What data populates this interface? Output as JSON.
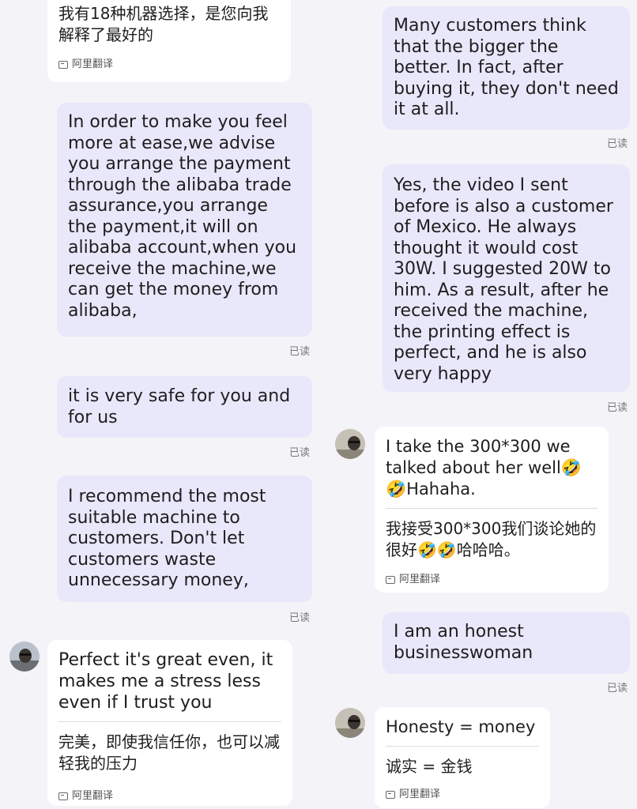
{
  "translate_tag": "阿里翻译",
  "read_receipt": "已读",
  "left_column": {
    "top_incoming": {
      "original": "我有18种机器选择，是您向我解释了最好的"
    },
    "msg1": {
      "text": "In order to make you feel more at ease,we advise you arrange the payment through the alibaba trade assurance,you arrange the payment,it will on alibaba account,when you receive the machine,we can get the money from alibaba,"
    },
    "msg2": {
      "text": "it is very safe for you and for us"
    },
    "msg3": {
      "text": "I recommend the most suitable machine to customers. Don't let customers waste unnecessary money,"
    },
    "incoming": {
      "original": "Perfect it's great even, it makes me a stress less even if I trust you",
      "translation": "完美，即使我信任你，也可以减轻我的压力"
    }
  },
  "right_column": {
    "msg1": {
      "text": "Many customers think that the bigger the better. In fact, after buying it, they don't need it at all."
    },
    "msg2": {
      "text": "Yes, the video I sent before is also a customer of Mexico. He always thought it would cost 30W. I suggested 20W to him. As a result, after he received the machine, the printing effect is perfect, and he is also very happy"
    },
    "incoming1": {
      "original": "I take the 300*300 we talked about her well🤣🤣Hahaha.",
      "translation": "我接受300*300我们谈论她的很好🤣🤣哈哈哈。"
    },
    "msg3": {
      "text": "I am an honest businesswoman"
    },
    "incoming2": {
      "original": "Honesty = money",
      "translation": "诚实 = 金钱"
    }
  }
}
